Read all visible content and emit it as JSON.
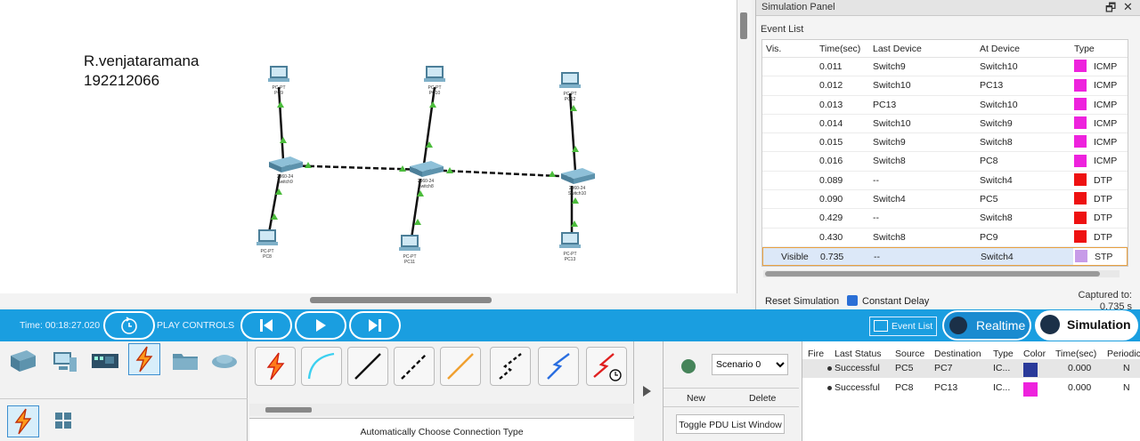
{
  "canvas": {
    "author_name": "R.venjataramana",
    "author_id": "192212066",
    "topology": {
      "switches": [
        {
          "model": "2960-24",
          "name": "Switch9"
        },
        {
          "model": "2960-24",
          "name": "Switch8"
        },
        {
          "model": "2960-24",
          "name": "Switch10"
        }
      ],
      "pcs": [
        {
          "model": "PC-PT",
          "name": "PC9"
        },
        {
          "model": "PC-PT",
          "name": "PC10"
        },
        {
          "model": "PC-PT",
          "name": "PC12"
        },
        {
          "model": "PC-PT",
          "name": "PC8"
        },
        {
          "model": "PC-PT",
          "name": "PC11"
        },
        {
          "model": "PC-PT",
          "name": "PC13"
        }
      ],
      "link_color": "#111111",
      "port_indicator_color": "#4cbc3c"
    }
  },
  "sim_panel": {
    "title": "Simulation Panel",
    "restore_icon": "restore-icon",
    "close_icon": "close-icon",
    "event_list_label": "Event List",
    "headers": {
      "vis": "Vis.",
      "time": "Time(sec)",
      "last": "Last Device",
      "at": "At Device",
      "type": "Type"
    },
    "events": [
      {
        "vis": "",
        "time": "0.011",
        "last": "Switch9",
        "at": "Switch10",
        "type": "ICMP",
        "color": "#ee22dd"
      },
      {
        "vis": "",
        "time": "0.012",
        "last": "Switch10",
        "at": "PC13",
        "type": "ICMP",
        "color": "#ee22dd"
      },
      {
        "vis": "",
        "time": "0.013",
        "last": "PC13",
        "at": "Switch10",
        "type": "ICMP",
        "color": "#ee22dd"
      },
      {
        "vis": "",
        "time": "0.014",
        "last": "Switch10",
        "at": "Switch9",
        "type": "ICMP",
        "color": "#ee22dd"
      },
      {
        "vis": "",
        "time": "0.015",
        "last": "Switch9",
        "at": "Switch8",
        "type": "ICMP",
        "color": "#ee22dd"
      },
      {
        "vis": "",
        "time": "0.016",
        "last": "Switch8",
        "at": "PC8",
        "type": "ICMP",
        "color": "#ee22dd"
      },
      {
        "vis": "",
        "time": "0.089",
        "last": "--",
        "at": "Switch4",
        "type": "DTP",
        "color": "#ee1111"
      },
      {
        "vis": "",
        "time": "0.090",
        "last": "Switch4",
        "at": "PC5",
        "type": "DTP",
        "color": "#ee1111"
      },
      {
        "vis": "",
        "time": "0.429",
        "last": "--",
        "at": "Switch8",
        "type": "DTP",
        "color": "#ee1111"
      },
      {
        "vis": "",
        "time": "0.430",
        "last": "Switch8",
        "at": "PC9",
        "type": "DTP",
        "color": "#ee1111"
      },
      {
        "vis": "Visible",
        "time": "0.735",
        "last": "--",
        "at": "Switch4",
        "type": "STP",
        "color": "#c79be8"
      }
    ],
    "reset_label": "Reset Simulation",
    "constant_delay_label": "Constant Delay",
    "constant_delay_checked": true,
    "captured_label": "Captured to:",
    "captured_value": "0.735 s"
  },
  "bluebar": {
    "time_label": "Time: 00:18:27.020",
    "play_controls_label": "PLAY CONTROLS",
    "event_list_button": "Event List",
    "realtime_label": "Realtime",
    "simulation_label": "Simulation",
    "color": "#1a9ee0"
  },
  "bottom": {
    "device_categories": [
      "switch-icon",
      "end-device-icon",
      "router-module-icon",
      "connections-icon",
      "folder-icon",
      "cloud-icon"
    ],
    "connection_types": [
      "auto-connection-icon",
      "console-cable-icon",
      "copper-straight-icon",
      "copper-cross-icon",
      "fiber-icon",
      "phone-cable-icon",
      "coaxial-icon",
      "serial-dce-icon"
    ],
    "auto_connect_label": "Automatically Choose Connection Type",
    "scenario": "Scenario 0",
    "new_label": "New",
    "delete_label": "Delete",
    "toggle_pdu_label": "Toggle PDU List Window",
    "pdu_headers": {
      "fire": "Fire",
      "status": "Last Status",
      "source": "Source",
      "dest": "Destination",
      "type": "Type",
      "color": "Color",
      "time": "Time(sec)",
      "periodic": "Periodic"
    },
    "pdus": [
      {
        "status": "Successful",
        "source": "PC5",
        "dest": "PC7",
        "type": "IC...",
        "color": "#2a3a9a",
        "time": "0.000",
        "periodic": "N"
      },
      {
        "status": "Successful",
        "source": "PC8",
        "dest": "PC13",
        "type": "IC...",
        "color": "#ee22dd",
        "time": "0.000",
        "periodic": "N"
      }
    ]
  }
}
